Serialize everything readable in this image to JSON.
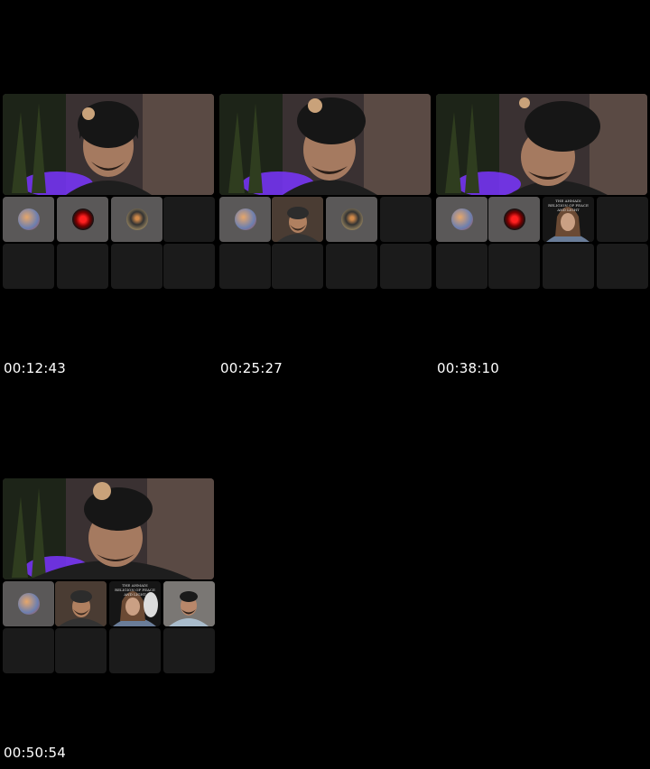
{
  "thumbnails": [
    {
      "timestamp": "00:12:43",
      "tiles": [
        "avatar-colorful",
        "avatar-red-eye",
        "avatar-figure",
        "empty",
        "empty",
        "empty",
        "empty",
        "empty"
      ]
    },
    {
      "timestamp": "00:25:27",
      "tiles": [
        "avatar-colorful",
        "video-man-beard",
        "avatar-figure",
        "empty",
        "empty",
        "empty",
        "empty",
        "empty"
      ]
    },
    {
      "timestamp": "00:38:10",
      "tiles": [
        "avatar-colorful",
        "avatar-red-eye",
        "video-woman",
        "empty",
        "empty",
        "empty",
        "empty",
        "empty"
      ],
      "video_caption": "THE AHMADI RELIGION OF PEACE AND LIGHT"
    },
    {
      "timestamp": "00:50:54",
      "tiles": [
        "avatar-colorful",
        "video-man-beard",
        "video-woman",
        "video-man-cap",
        "empty",
        "empty",
        "empty",
        "empty"
      ],
      "video_caption": "THE AHMADI RELIGION OF PEACE AND LIGHT"
    }
  ],
  "colors": {
    "background": "#000000",
    "tile_empty": "#1b1b1b",
    "tile_avatar": "#5a5858",
    "accent_purple": "#7a35ff"
  }
}
